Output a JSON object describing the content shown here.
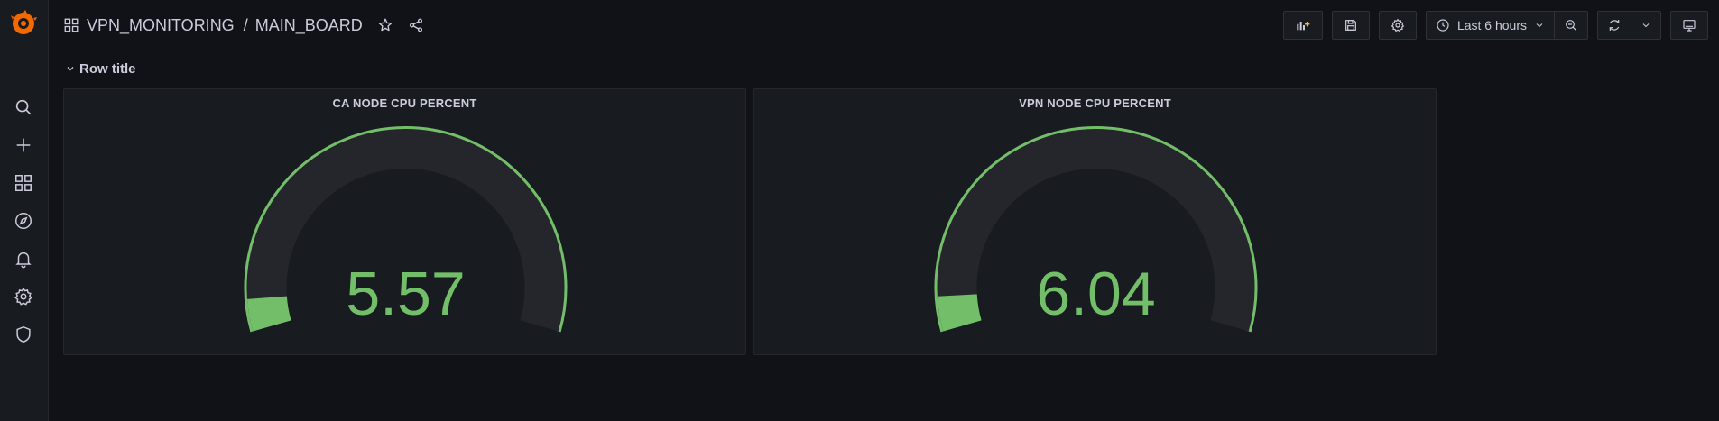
{
  "sidebar": {
    "items": [
      {
        "name": "search",
        "icon": "search-icon"
      },
      {
        "name": "create",
        "icon": "plus-icon"
      },
      {
        "name": "dashboards",
        "icon": "grid-icon"
      },
      {
        "name": "explore",
        "icon": "compass-icon"
      },
      {
        "name": "alerting",
        "icon": "bell-icon"
      },
      {
        "name": "configuration",
        "icon": "gear-icon"
      },
      {
        "name": "server-admin",
        "icon": "shield-icon"
      }
    ]
  },
  "header": {
    "folder": "VPN_MONITORING",
    "separator": "/",
    "dashboard": "MAIN_BOARD"
  },
  "toolbar": {
    "time_range": "Last 6 hours"
  },
  "row": {
    "title": "Row title"
  },
  "panels": [
    {
      "title": "CA NODE CPU PERCENT",
      "value": "5.57",
      "numeric": 5.57,
      "min": 0,
      "max": 100
    },
    {
      "title": "VPN NODE CPU PERCENT",
      "value": "6.04",
      "numeric": 6.04,
      "min": 0,
      "max": 100
    }
  ],
  "colors": {
    "accent_green": "#73bf69",
    "background": "#111217",
    "panel": "#181b1f",
    "gauge_track": "#25262b"
  }
}
